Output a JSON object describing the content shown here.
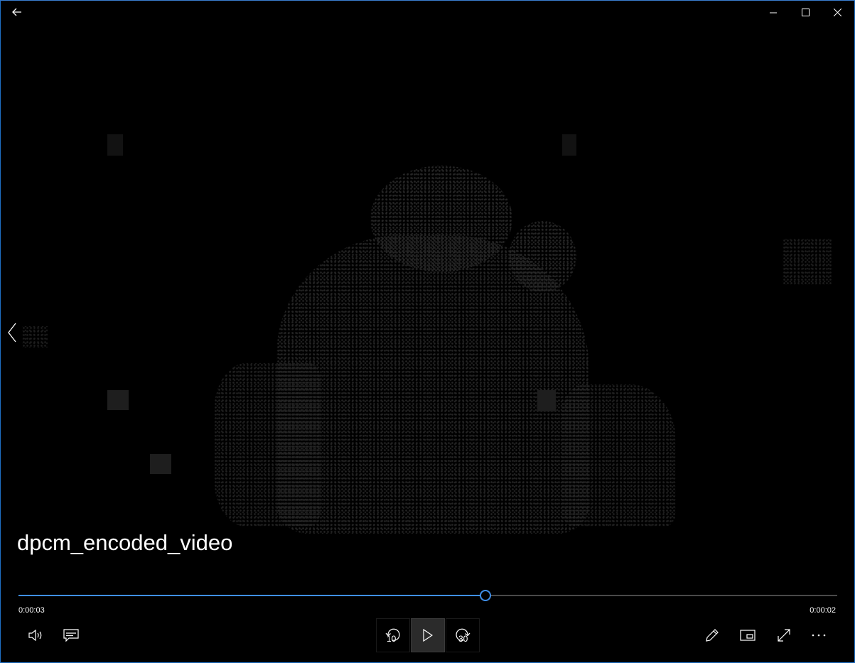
{
  "window": {
    "controls": {
      "back": "back-arrow-icon",
      "minimize": "minimize-icon",
      "maximize": "maximize-icon",
      "close": "close-icon"
    },
    "accent_color": "#3f8fe8"
  },
  "video": {
    "title": "dpcm_encoded_video",
    "progress_fraction": 0.57
  },
  "playback": {
    "elapsed": "0:00:03",
    "remaining": "0:00:02"
  },
  "controls": {
    "skip_back_seconds": "10",
    "skip_forward_seconds": "30",
    "left": [
      "volume-icon",
      "subtitles-icon"
    ],
    "center": [
      "skip-back-icon",
      "play-icon",
      "skip-forward-icon"
    ],
    "right": [
      "pen-icon",
      "mini-view-icon",
      "fullscreen-icon",
      "more-icon"
    ]
  }
}
